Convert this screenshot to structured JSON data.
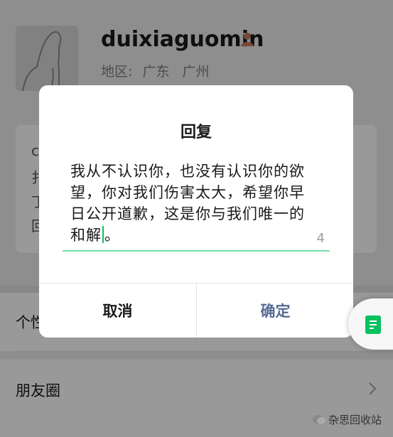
{
  "profile": {
    "username": "duixiaguomin",
    "region_label": "地区:",
    "region_province": "广东",
    "region_city": "广州"
  },
  "info_card": {
    "visible_letters": [
      "c",
      "扌",
      "丁",
      "回"
    ]
  },
  "list": {
    "item_1_label": "个性签名",
    "item_2_label": "朋友圈"
  },
  "dialog": {
    "title": "回复",
    "message_before_caret": "我从不认识你，也没有认识你的欲望，你对我们伤害太大，希望你早日公开道歉，这是你与我们唯一的和解",
    "message_after_caret": "。",
    "char_count": "4",
    "cancel_label": "取消",
    "confirm_label": "确定"
  },
  "watermark": {
    "text": "杂思回收站"
  },
  "colors": {
    "accent_green": "#07c160",
    "confirm_blue": "#576b95"
  }
}
